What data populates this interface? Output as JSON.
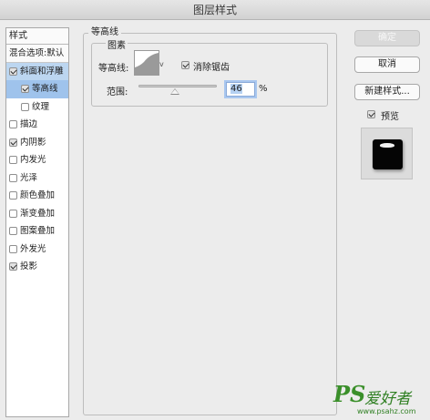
{
  "window": {
    "title": "图层样式"
  },
  "style_list": {
    "header": "样式",
    "blend": "混合选项:默认",
    "items": [
      {
        "label": "斜面和浮雕",
        "checked": true
      },
      {
        "label": "等高线",
        "checked": true
      },
      {
        "label": "纹理",
        "checked": false
      },
      {
        "label": "描边",
        "checked": false
      },
      {
        "label": "内阴影",
        "checked": true
      },
      {
        "label": "内发光",
        "checked": false
      },
      {
        "label": "光泽",
        "checked": false
      },
      {
        "label": "颜色叠加",
        "checked": false
      },
      {
        "label": "渐变叠加",
        "checked": false
      },
      {
        "label": "图案叠加",
        "checked": false
      },
      {
        "label": "外发光",
        "checked": false
      },
      {
        "label": "投影",
        "checked": true
      }
    ]
  },
  "panel": {
    "title": "等高线",
    "group": "图素",
    "contour_label": "等高线:",
    "dropdown_icon": "v",
    "antialias_label": "消除锯齿",
    "antialias_checked": true,
    "range_label": "范围:",
    "range_value": "46",
    "range_unit": "%",
    "range_slider_percent": 46
  },
  "buttons": {
    "ok": "确定",
    "cancel": "取消",
    "new_style": "新建样式...",
    "preview_label": "预览",
    "preview_checked": true
  },
  "watermark": {
    "logo": "PS",
    "text": "爱好者",
    "url": "www.psahz.com"
  }
}
